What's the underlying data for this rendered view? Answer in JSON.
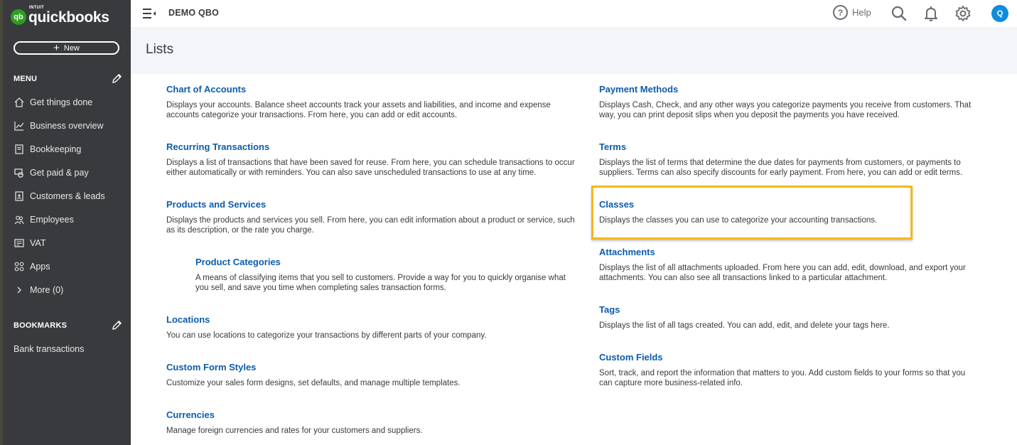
{
  "brand": {
    "intuit": "INTUIT",
    "name": "quickbooks",
    "mark": "qb"
  },
  "sidebar": {
    "new_label": "New",
    "menu_header": "MENU",
    "items": [
      {
        "label": "Get things done",
        "icon": "home-icon"
      },
      {
        "label": "Business overview",
        "icon": "chart-line-icon"
      },
      {
        "label": "Bookkeeping",
        "icon": "book-icon"
      },
      {
        "label": "Get paid & pay",
        "icon": "payment-icon"
      },
      {
        "label": "Customers & leads",
        "icon": "contacts-icon"
      },
      {
        "label": "Employees",
        "icon": "people-icon"
      },
      {
        "label": "VAT",
        "icon": "tax-icon"
      },
      {
        "label": "Apps",
        "icon": "grid-icon"
      },
      {
        "label": "More (0)",
        "icon": "chevron-right-icon"
      }
    ],
    "bookmarks_header": "BOOKMARKS",
    "bookmarks": [
      {
        "label": "Bank transactions"
      }
    ]
  },
  "topbar": {
    "company": "DEMO QBO",
    "help_label": "Help",
    "avatar_initial": "Q"
  },
  "page": {
    "title": "Lists"
  },
  "lists": {
    "left": [
      {
        "title": "Chart of Accounts",
        "desc": [
          "Displays your accounts. Balance sheet accounts track your assets and liabilities, and income and expense",
          "accounts categorize your transactions. From here, you can add or edit accounts."
        ]
      },
      {
        "title": "Recurring Transactions",
        "desc": [
          "Displays a list of transactions that have been saved for reuse. From here, you can schedule transactions to occur",
          "either automatically or with reminders. You can also save unscheduled transactions to use at any time."
        ]
      },
      {
        "title": "Products and Services",
        "desc": [
          "Displays the products and services you sell. From here, you can edit information about a product or service, such",
          "as its description, or the rate you charge."
        ]
      },
      {
        "title": "Product Categories",
        "desc": [
          "A means of classifying items that you sell to customers. Provide a way for you to quickly organise what",
          "you sell, and save you time when completing sales transaction forms."
        ]
      },
      {
        "title": "Locations",
        "desc": [
          "You can use locations to categorize your transactions by different parts of your company."
        ]
      },
      {
        "title": "Custom Form Styles",
        "desc": [
          "Customize your sales form designs, set defaults, and manage multiple templates."
        ]
      },
      {
        "title": "Currencies",
        "desc": [
          "Manage foreign currencies and rates for your customers and suppliers."
        ]
      }
    ],
    "right": [
      {
        "title": "Payment Methods",
        "desc": [
          "Displays Cash, Check, and any other ways you categorize payments you receive from customers. That",
          "way, you can print deposit slips when you deposit the payments you have received."
        ]
      },
      {
        "title": "Terms",
        "desc": [
          "Displays the list of terms that determine the due dates for payments from customers, or payments to",
          "suppliers. Terms can also specify discounts for early payment. From here, you can add or edit terms."
        ]
      },
      {
        "title": "Classes",
        "desc": [
          "Displays the classes you can use to categorize your accounting transactions."
        ]
      },
      {
        "title": "Attachments",
        "desc": [
          "Displays the list of all attachments uploaded. From here you can add, edit, download, and export your",
          "attachments. You can also see all transactions linked to a particular attachment."
        ]
      },
      {
        "title": "Tags",
        "desc": [
          "Displays the list of all tags created. You can add, edit, and delete your tags here."
        ]
      },
      {
        "title": "Custom Fields",
        "desc": [
          "Sort, track, and report the information that matters to you. Add custom fields to your forms so that you",
          "can capture more business-related info."
        ]
      }
    ]
  },
  "colors": {
    "sidebar": "#393a3d",
    "link": "#0b5cad",
    "highlight": "#f2b81d",
    "brand": "#2ca01c",
    "avatar": "#0d8ddb"
  }
}
